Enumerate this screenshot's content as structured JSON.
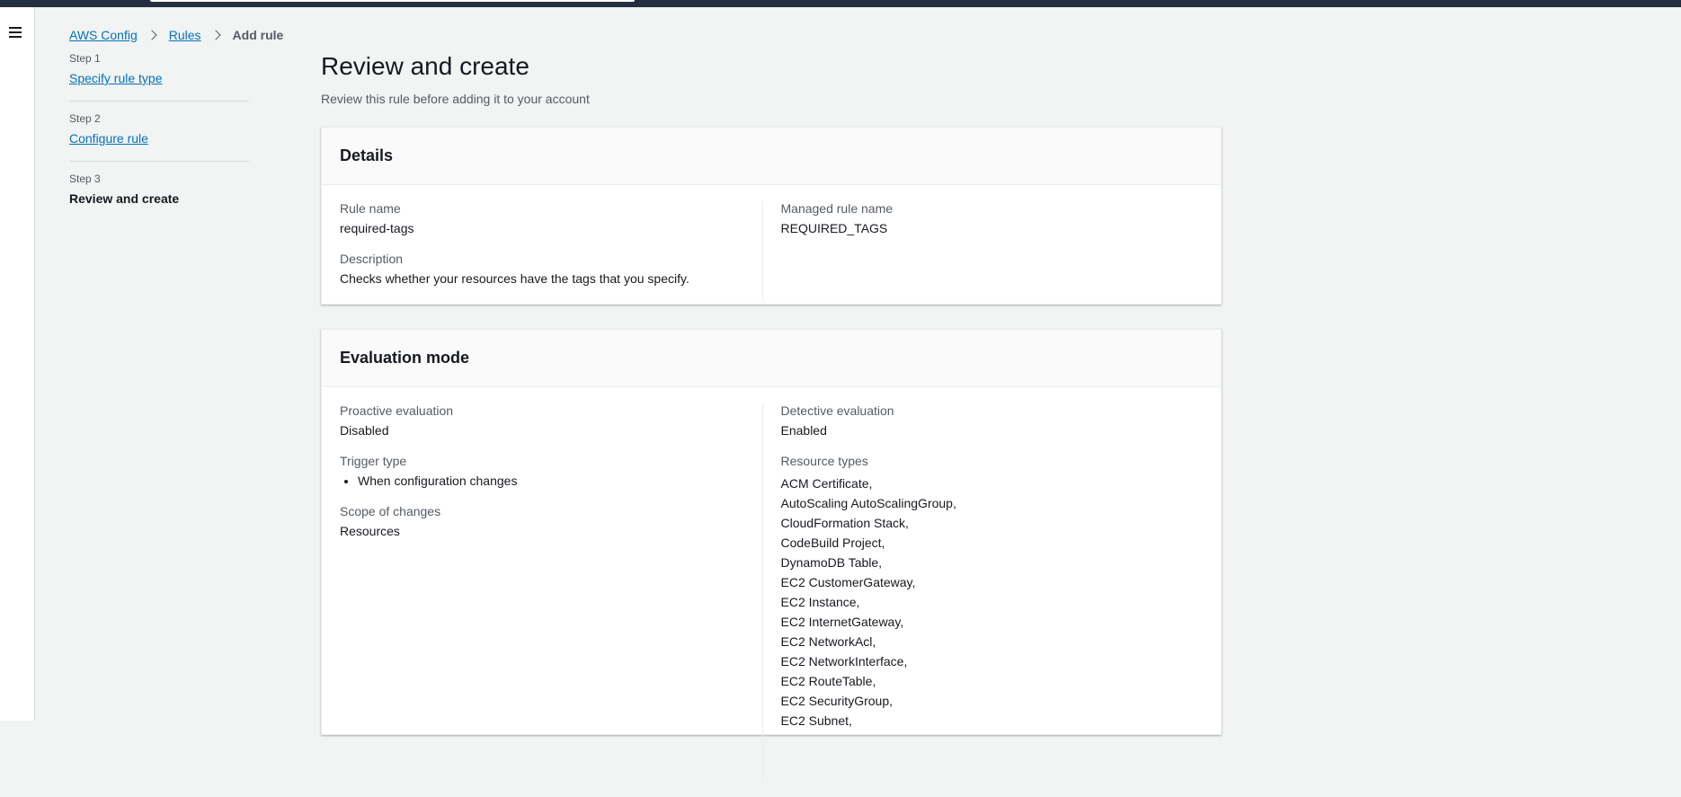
{
  "breadcrumb": {
    "items": [
      "AWS Config",
      "Rules"
    ],
    "current": "Add rule"
  },
  "steps": [
    {
      "number": "Step 1",
      "label": "Specify rule type"
    },
    {
      "number": "Step 2",
      "label": "Configure rule"
    },
    {
      "number": "Step 3",
      "label": "Review and create"
    }
  ],
  "page": {
    "title": "Review and create",
    "description": "Review this rule before adding it to your account"
  },
  "details": {
    "title": "Details",
    "rule_name_label": "Rule name",
    "rule_name": "required-tags",
    "description_label": "Description",
    "description": "Checks whether your resources have the tags that you specify.",
    "managed_rule_label": "Managed rule name",
    "managed_rule": "REQUIRED_TAGS"
  },
  "evaluation": {
    "title": "Evaluation mode",
    "proactive_label": "Proactive evaluation",
    "proactive": "Disabled",
    "trigger_label": "Trigger type",
    "trigger_items": [
      "When configuration changes"
    ],
    "scope_label": "Scope of changes",
    "scope": "Resources",
    "detective_label": "Detective evaluation",
    "detective": "Enabled",
    "resource_types_label": "Resource types",
    "resource_types": [
      "ACM Certificate,",
      "AutoScaling AutoScalingGroup,",
      "CloudFormation Stack,",
      "CodeBuild Project,",
      "DynamoDB Table,",
      "EC2 CustomerGateway,",
      "EC2 Instance,",
      "EC2 InternetGateway,",
      "EC2 NetworkAcl,",
      "EC2 NetworkInterface,",
      "EC2 RouteTable,",
      "EC2 SecurityGroup,",
      "EC2 Subnet,"
    ]
  },
  "icons": {
    "menu": "hamburger-menu-icon",
    "breadcrumb_separator": "chevron-right-icon"
  },
  "colors": {
    "link": "#0073bb",
    "header_bar": "#232f3e",
    "background": "#f2f3f3"
  }
}
